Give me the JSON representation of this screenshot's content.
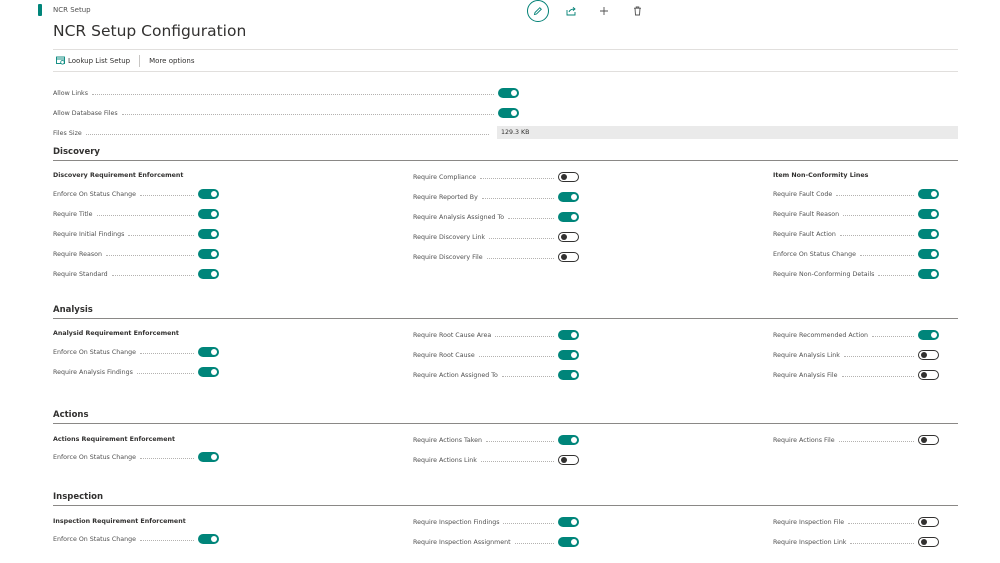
{
  "breadcrumb": "NCR Setup",
  "page_title": "NCR Setup Configuration",
  "top_actions": [
    {
      "name": "edit-icon"
    },
    {
      "name": "share-icon"
    },
    {
      "name": "add-icon"
    },
    {
      "name": "delete-icon"
    }
  ],
  "toolbar": {
    "lookup_list_setup": "Lookup List Setup",
    "more_options": "More options"
  },
  "general": {
    "allow_links": {
      "label": "Allow Links",
      "on": true
    },
    "allow_database_files": {
      "label": "Allow Database Files",
      "on": true
    },
    "files_size": {
      "label": "Files Size",
      "value": "129.3 KB"
    }
  },
  "sections": {
    "discovery": {
      "title": "Discovery",
      "col1_header": "Discovery Requirement Enforcement",
      "col1": [
        {
          "label": "Enforce On Status Change",
          "on": true
        },
        {
          "label": "Require Title",
          "on": true
        },
        {
          "label": "Require Initial Findings",
          "on": true
        },
        {
          "label": "Require Reason",
          "on": true
        },
        {
          "label": "Require Standard",
          "on": true
        }
      ],
      "col2": [
        {
          "label": "Require Compliance",
          "on": false
        },
        {
          "label": "Require Reported By",
          "on": true
        },
        {
          "label": "Require Analysis Assigned To",
          "on": true
        },
        {
          "label": "Require Discovery Link",
          "on": false
        },
        {
          "label": "Require Discovery File",
          "on": false
        }
      ],
      "col3_header": "Item Non-Conformity Lines",
      "col3": [
        {
          "label": "Require Fault Code",
          "on": true
        },
        {
          "label": "Require Fault Reason",
          "on": true
        },
        {
          "label": "Require Fault Action",
          "on": true
        },
        {
          "label": "Enforce On Status Change",
          "on": true
        },
        {
          "label": "Require Non-Conforming Details",
          "on": true
        }
      ]
    },
    "analysis": {
      "title": "Analysis",
      "col1_header": "Analysid Requirement Enforcement",
      "col1": [
        {
          "label": "Enforce On Status Change",
          "on": true
        },
        {
          "label": "Require Analysis Findings",
          "on": true
        }
      ],
      "col2": [
        {
          "label": "Require Root Cause Area",
          "on": true
        },
        {
          "label": "Require Root Cause",
          "on": true
        },
        {
          "label": "Require Action Assigned To",
          "on": true
        }
      ],
      "col3": [
        {
          "label": "Require Recommended Action",
          "on": true
        },
        {
          "label": "Require Analysis Link",
          "on": false
        },
        {
          "label": "Require Analysis File",
          "on": false
        }
      ]
    },
    "actions": {
      "title": "Actions",
      "col1_header": "Actions Requirement Enforcement",
      "col1": [
        {
          "label": "Enforce On Status Change",
          "on": true
        }
      ],
      "col2": [
        {
          "label": "Require Actions Taken",
          "on": true
        },
        {
          "label": "Require Actions Link",
          "on": false
        }
      ],
      "col3": [
        {
          "label": "Require Actions File",
          "on": false
        }
      ]
    },
    "inspection": {
      "title": "Inspection",
      "col1_header": "Inspection Requirement Enforcement",
      "col1": [
        {
          "label": "Enforce On Status Change",
          "on": true
        }
      ],
      "col2": [
        {
          "label": "Require Inspection Findings",
          "on": true
        },
        {
          "label": "Require Inspection Assignment",
          "on": true
        }
      ],
      "col3": [
        {
          "label": "Require Inspection File",
          "on": false
        },
        {
          "label": "Require Inspection Link",
          "on": false
        }
      ]
    }
  },
  "colors": {
    "accent": "#00857a"
  }
}
